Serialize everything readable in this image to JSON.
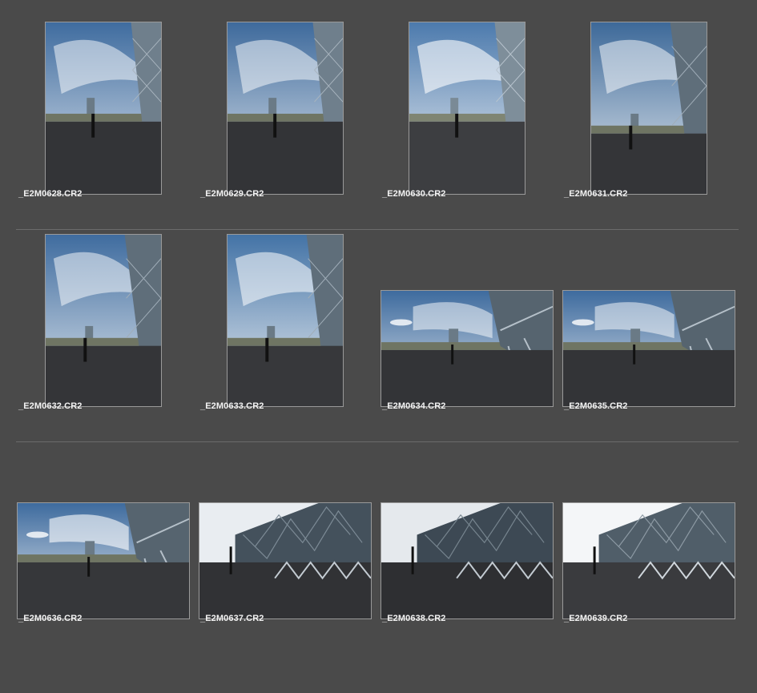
{
  "browser": {
    "files": [
      {
        "name": "_E2M0628.CR2",
        "orientation": "portrait",
        "view": "tower-right"
      },
      {
        "name": "_E2M0629.CR2",
        "orientation": "portrait",
        "view": "tower-right"
      },
      {
        "name": "_E2M0630.CR2",
        "orientation": "portrait",
        "view": "tower-right-bright"
      },
      {
        "name": "_E2M0631.CR2",
        "orientation": "portrait",
        "view": "tower-right"
      },
      {
        "name": "_E2M0632.CR2",
        "orientation": "portrait",
        "view": "tower-right"
      },
      {
        "name": "_E2M0633.CR2",
        "orientation": "portrait",
        "view": "tower-right"
      },
      {
        "name": "_E2M0634.CR2",
        "orientation": "landscape",
        "view": "building-right"
      },
      {
        "name": "_E2M0635.CR2",
        "orientation": "landscape",
        "view": "building-right"
      },
      {
        "name": "_E2M0636.CR2",
        "orientation": "landscape",
        "view": "building-right"
      },
      {
        "name": "_E2M0637.CR2",
        "orientation": "landscape",
        "view": "facade"
      },
      {
        "name": "_E2M0638.CR2",
        "orientation": "landscape",
        "view": "facade"
      },
      {
        "name": "_E2M0639.CR2",
        "orientation": "landscape",
        "view": "facade-bright"
      }
    ]
  },
  "colors": {
    "background": "#4a4a4a",
    "thumbnail_border": "#9a9a9a",
    "filename_text": "#f2f2f2",
    "row_separator": "#6b6b6b"
  }
}
